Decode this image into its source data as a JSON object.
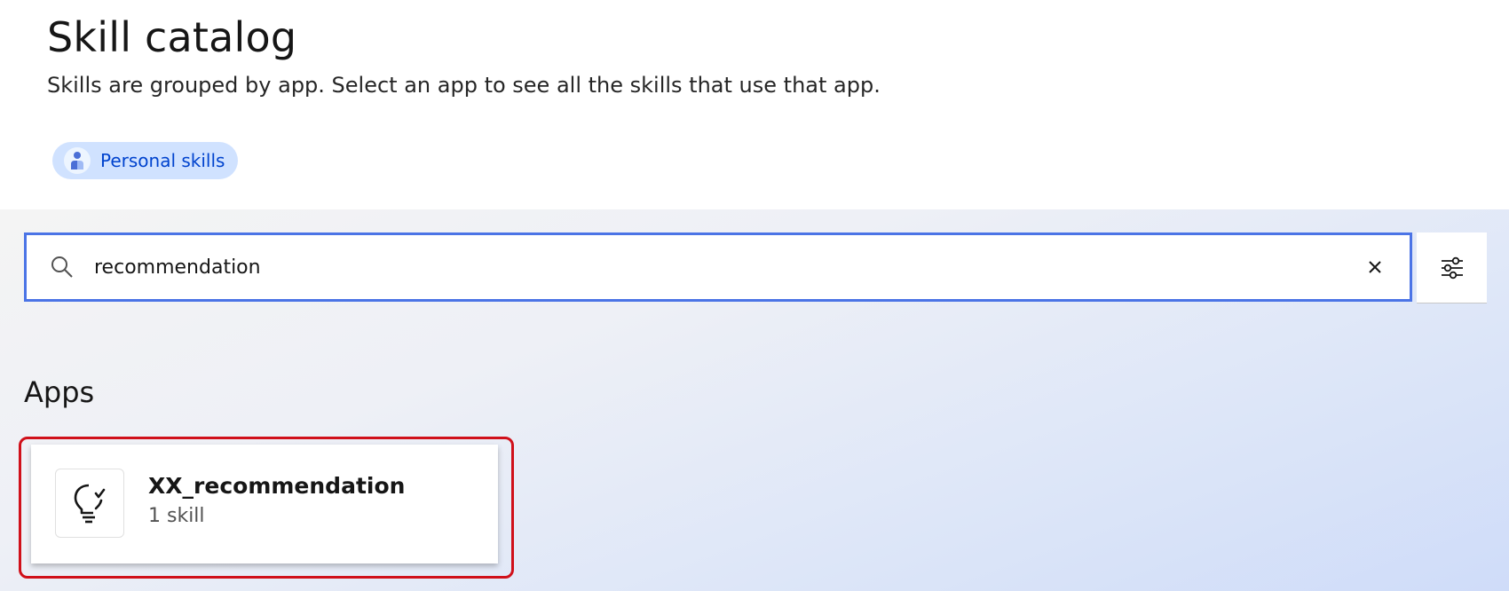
{
  "header": {
    "title": "Skill catalog",
    "description": "Skills are grouped by app. Select an app to see all the skills that use that app.",
    "tag_label": "Personal skills"
  },
  "search": {
    "value": "recommendation",
    "placeholder": ""
  },
  "apps_section": {
    "title": "Apps",
    "items": [
      {
        "name": "XX_recommendation",
        "count": "1 skill",
        "icon": "lightbulb-check-icon"
      }
    ]
  },
  "colors": {
    "accent": "#4b74e6",
    "tag_bg": "#d0e2ff",
    "tag_text": "#0043ce",
    "highlight": "#d0101a"
  }
}
